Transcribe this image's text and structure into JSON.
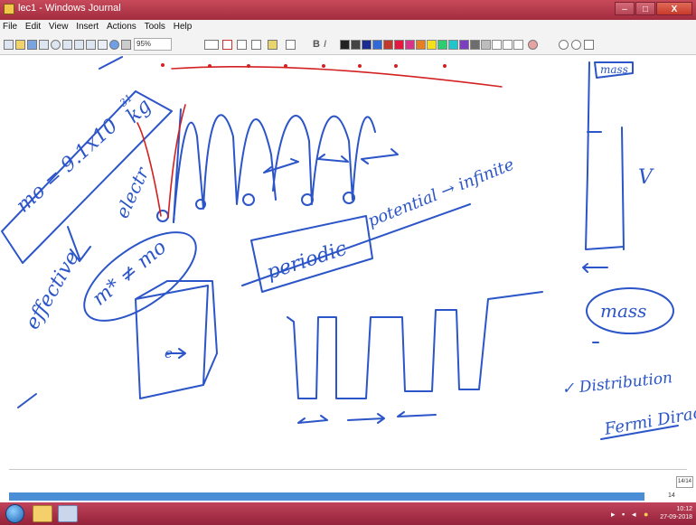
{
  "window": {
    "title": "lec1 - Windows Journal",
    "minimize": "–",
    "maximize": "□",
    "close": "X"
  },
  "menu": [
    "File",
    "Edit",
    "View",
    "Insert",
    "Actions",
    "Tools",
    "Help"
  ],
  "toolbar": {
    "zoom": "95%",
    "bold": "B",
    "italic": "I"
  },
  "palette": [
    "#222222",
    "#444444",
    "#1b2b8f",
    "#2e6bd8",
    "#c0392b",
    "#e5173f",
    "#d8358a",
    "#e67e22",
    "#f5e11b",
    "#2ecc71",
    "#20c5c9",
    "#7b3fbf",
    "#6d6d6d",
    "#bdbdbd",
    "#ffffff",
    "#ffffff",
    "#ffffff"
  ],
  "ink": {
    "m0_text": "mo = 9.1x10",
    "exp_text": "-31",
    "kg_text": "kg",
    "effective": "effective",
    "electron": "electr",
    "mstar": "m* ≠ mo",
    "periodic": "periodic",
    "potential": "potential → infinite",
    "mass_top": "mass",
    "v_label": "V",
    "mass": "mass",
    "distribution": "✓ Distribution",
    "fermi_dirac": "Fermi Dirac",
    "e_label": "e"
  },
  "page": {
    "counter": "14/14",
    "number": "14"
  },
  "clock": {
    "time": "10:12",
    "date": "27-09-2018"
  },
  "colors": {
    "ink": "#2b55c8",
    "red_ink": "#d32020",
    "taskbar": "#a83047",
    "progress": "#4a8fd6"
  }
}
